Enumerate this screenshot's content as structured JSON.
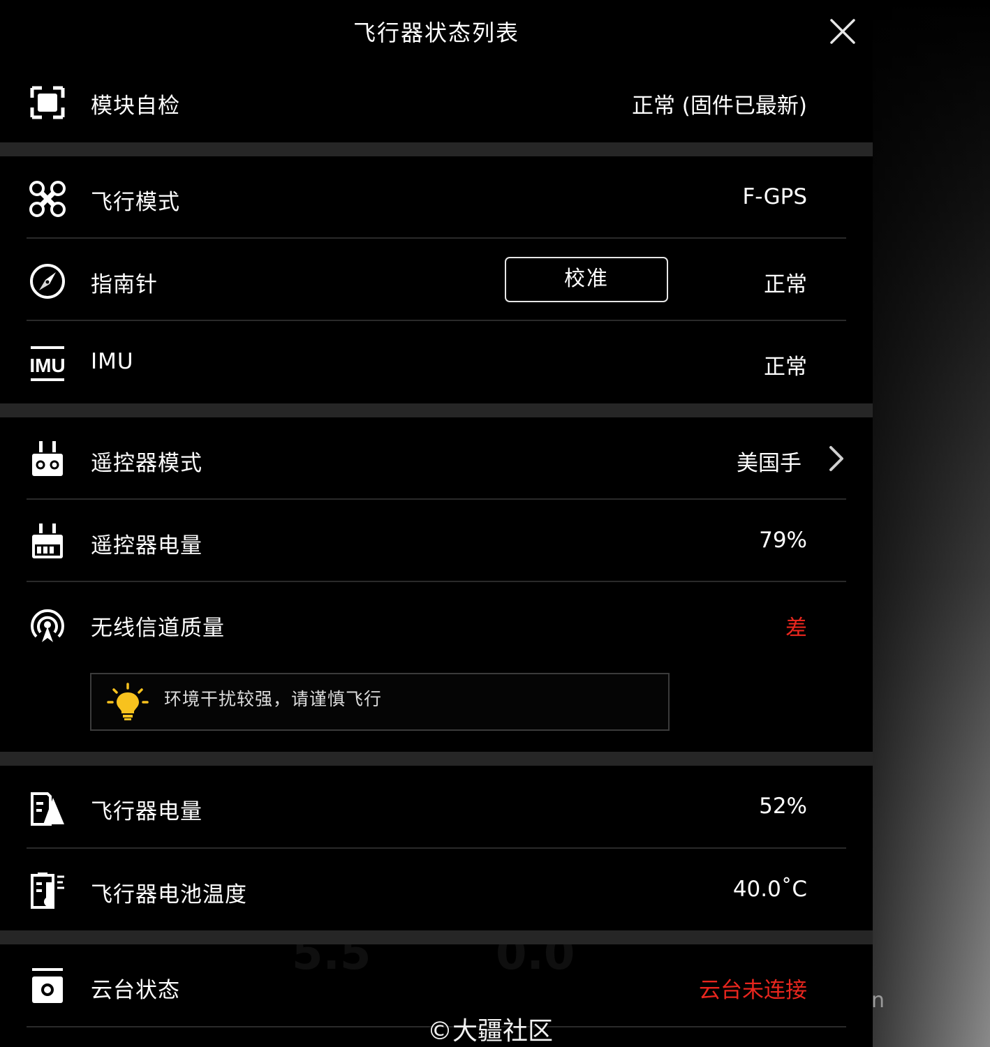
{
  "header": {
    "title": "飞行器状态列表"
  },
  "icons": {
    "close": "close-icon",
    "module": "module-selfcheck-icon",
    "flight_mode": "drone-icon",
    "compass": "compass-icon",
    "imu": "imu-icon",
    "rc_mode": "remote-controller-icon",
    "rc_battery": "remote-controller-battery-icon",
    "wireless": "wireless-signal-icon",
    "bulb": "lightbulb-icon",
    "aircraft_battery": "aircraft-battery-icon",
    "battery_temp": "battery-temperature-icon",
    "gimbal": "gimbal-camera-icon",
    "chevron": "chevron-right-icon"
  },
  "rows": {
    "module_check": {
      "label": "模块自检",
      "value": "正常 (固件已最新)"
    },
    "flight_mode": {
      "label": "飞行模式",
      "value": "F-GPS"
    },
    "compass": {
      "label": "指南针",
      "value": "正常",
      "button": "校准"
    },
    "imu": {
      "label": "IMU",
      "value": "正常"
    },
    "rc_mode": {
      "label": "遥控器模式",
      "value": "美国手"
    },
    "rc_battery": {
      "label": "遥控器电量",
      "value": "79%"
    },
    "wireless": {
      "label": "无线信道质量",
      "value": "差",
      "warning": "环境干扰较强，请谨慎飞行"
    },
    "aircraft_battery": {
      "label": "飞行器电量",
      "value": "52%"
    },
    "battery_temp": {
      "label": "飞行器电池温度",
      "value": "40.0˚C"
    },
    "gimbal": {
      "label": "云台状态",
      "value": "云台未连接"
    }
  },
  "colors": {
    "background": "#000000",
    "separator": "#262626",
    "alert": "#e8261e",
    "bulb": "#f7c21e"
  },
  "watermark": "©大疆社区"
}
